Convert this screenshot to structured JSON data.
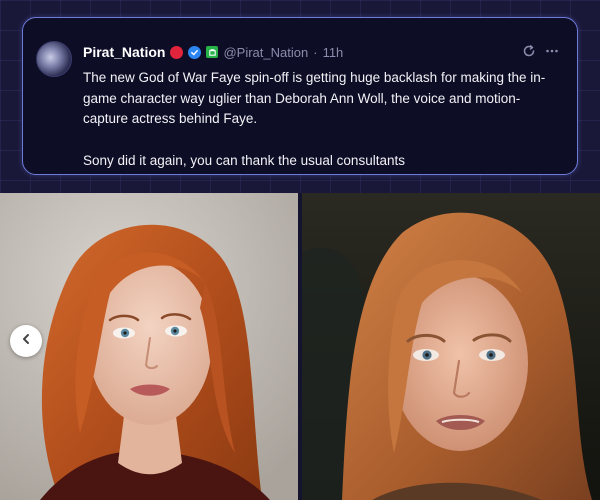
{
  "tweet": {
    "display_name": "Pirat_Nation",
    "handle": "@Pirat_Nation",
    "separator": "·",
    "time": "11h",
    "text_p1": "The new God of War Faye spin-off is getting huge backlash for making the in-game character way uglier than Deborah Ann Woll, the voice and motion-capture actress behind Faye.",
    "text_p2": "Sony did it again, you can thank the usual consultants",
    "badges": [
      "red-circle-badge",
      "verified-badge",
      "affiliate-badge"
    ],
    "actions": [
      "refresh-icon",
      "more-icon"
    ]
  },
  "media": {
    "images": [
      "actress-photo",
      "game-character-render"
    ],
    "carousel_control": "chevron-left-icon"
  },
  "colors": {
    "background": "#1a1838",
    "card_border": "#6b7bd8",
    "card_bg": "#0e0d26",
    "text": "#f1f1f6",
    "muted": "#8a8cab",
    "verified": "#2b86f2",
    "red_badge": "#e0243b",
    "affiliate": "#27b24a"
  }
}
